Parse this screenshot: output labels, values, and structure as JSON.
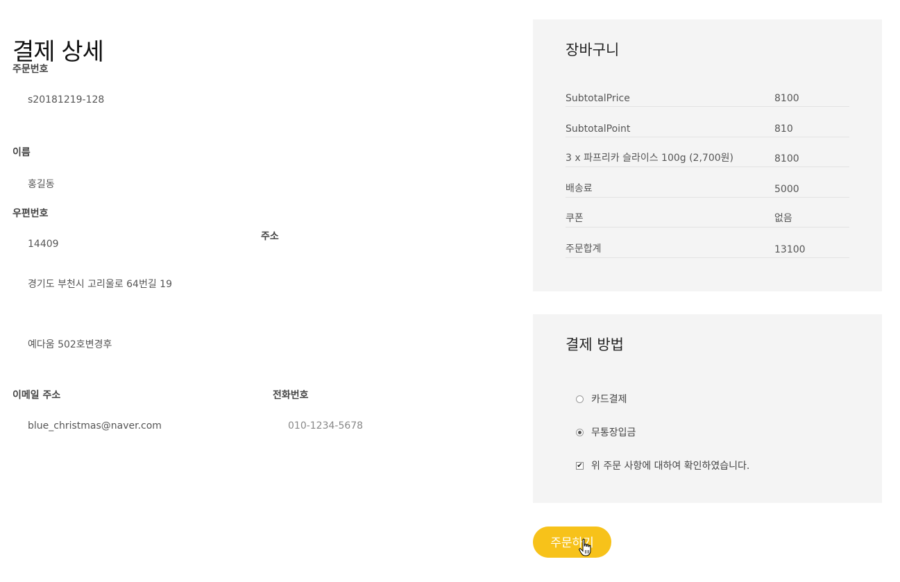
{
  "page_title": "결제 상세",
  "order": {
    "order_no_label": "주문번호",
    "order_no": "s20181219-128",
    "name_label": "이름",
    "name": "홍길동",
    "zip_label": "우편번호",
    "zip": "14409",
    "address_label": "주소",
    "address1": "경기도 부천시 고리울로 64번길 19",
    "address2": "예다움 502호변경후",
    "email_label": "이메일 주소",
    "email": "blue_christmas@naver.com",
    "phone_label": "전화번호",
    "phone": "010-1234-5678"
  },
  "cart": {
    "title": "장바구니",
    "rows": [
      {
        "key": "SubtotalPrice",
        "value": "8100"
      },
      {
        "key": "SubtotalPoint",
        "value": "810"
      },
      {
        "key": "3 x 파프리카 슬라이스 100g (2,700원)",
        "value": "8100"
      },
      {
        "key": "배송료",
        "value": "5000"
      },
      {
        "key": "쿠폰",
        "value": "없음"
      },
      {
        "key": "주문합계",
        "value": "13100"
      }
    ]
  },
  "payment": {
    "title": "결제 방법",
    "options": [
      {
        "label": "카드결제",
        "selected": false
      },
      {
        "label": "무통장입금",
        "selected": true
      }
    ],
    "confirm_label": "위 주문 사항에 대하여 확인하였습니다.",
    "confirm_checked": true
  },
  "order_button": "주문하기",
  "colors": {
    "accent": "#f7c21a",
    "panel_bg": "#f4f4f4"
  }
}
